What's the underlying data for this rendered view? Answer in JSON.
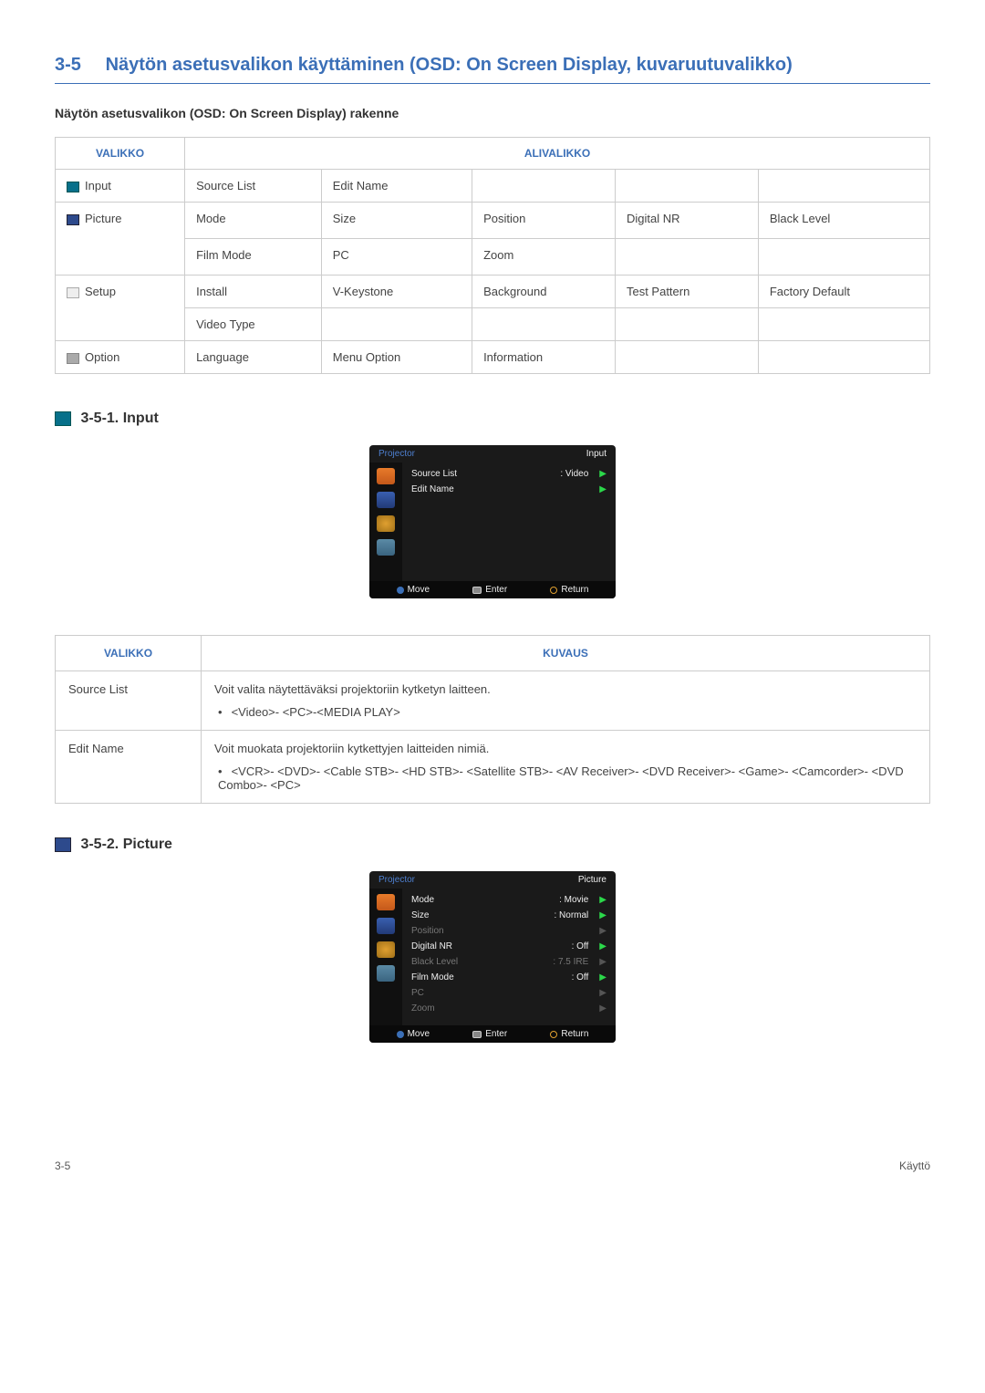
{
  "heading": {
    "number": "3-5",
    "title": "Näytön asetusvalikon käyttäminen (OSD: On Screen Display, kuvaruutuvalikko)"
  },
  "structure_title": "Näytön asetusvalikon (OSD: On Screen Display) rakenne",
  "structure_table": {
    "headers": {
      "menu": "VALIKKO",
      "submenu": "ALIVALIKKO"
    },
    "rows": [
      {
        "menu": "Input",
        "icon": "input",
        "cells": [
          "Source List",
          "Edit Name",
          "",
          "",
          ""
        ]
      },
      {
        "menu": "Picture",
        "icon": "picture",
        "rowspan": 2,
        "cells": [
          "Mode",
          "Size",
          "Position",
          "Digital NR",
          "Black Level"
        ]
      },
      {
        "menu": "",
        "cells": [
          "Film Mode",
          "PC",
          "Zoom",
          "",
          ""
        ]
      },
      {
        "menu": "Setup",
        "icon": "setup",
        "rowspan": 2,
        "cells": [
          "Install",
          "V-Keystone",
          "Background",
          "Test Pattern",
          "Factory Default"
        ]
      },
      {
        "menu": "",
        "cells": [
          "Video Type",
          "",
          "",
          "",
          ""
        ]
      },
      {
        "menu": "Option",
        "icon": "option",
        "cells": [
          "Language",
          "Menu Option",
          "Information",
          "",
          ""
        ]
      }
    ]
  },
  "sub_input": {
    "title": "3-5-1. Input",
    "osd": {
      "top_left": "Projector",
      "top_right": "Input",
      "rows": [
        {
          "label": "Source List",
          "value": ": Video",
          "arrow": true
        },
        {
          "label": "Edit Name",
          "value": "",
          "arrow": true
        }
      ],
      "bottom": {
        "move": "Move",
        "enter": "Enter",
        "return": "Return"
      }
    },
    "desc_headers": {
      "menu": "VALIKKO",
      "desc": "KUVAUS"
    },
    "desc_rows": [
      {
        "name": "Source List",
        "text": "Voit valita näytettäväksi projektoriin kytketyn laitteen.",
        "bullet": "<Video>- <PC>-<MEDIA PLAY>"
      },
      {
        "name": "Edit Name",
        "text": "Voit muokata projektoriin kytkettyjen laitteiden nimiä.",
        "bullet": "<VCR>- <DVD>- <Cable STB>- <HD STB>- <Satellite STB>- <AV Receiver>- <DVD Receiver>- <Game>- <Camcorder>- <DVD Combo>- <PC>"
      }
    ]
  },
  "sub_picture": {
    "title": "3-5-2. Picture",
    "osd": {
      "top_left": "Projector",
      "top_right": "Picture",
      "rows": [
        {
          "label": "Mode",
          "value": ": Movie",
          "arrow": true
        },
        {
          "label": "Size",
          "value": ": Normal",
          "arrow": true
        },
        {
          "label": "Position",
          "value": "",
          "arrow": true,
          "dim": true
        },
        {
          "label": "Digital NR",
          "value": ": Off",
          "arrow": true
        },
        {
          "label": "Black Level",
          "value": ": 7.5 IRE",
          "arrow": true,
          "dim": true
        },
        {
          "label": "Film Mode",
          "value": ": Off",
          "arrow": true
        },
        {
          "label": "PC",
          "value": "",
          "arrow": true,
          "dim": true
        },
        {
          "label": "Zoom",
          "value": "",
          "arrow": true,
          "dim": true
        }
      ],
      "bottom": {
        "move": "Move",
        "enter": "Enter",
        "return": "Return"
      }
    }
  },
  "footer": {
    "left": "3-5",
    "right": "Käyttö"
  }
}
